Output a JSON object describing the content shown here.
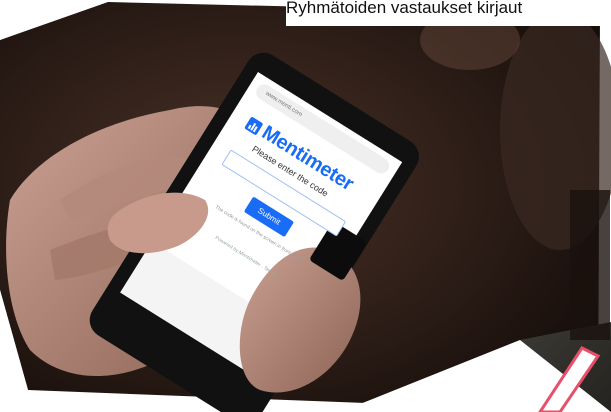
{
  "caption": {
    "text": "Ryhmätoiden vastaukset kirjaut"
  },
  "phone": {
    "url": "www.menti.com",
    "brand": "Mentimeter",
    "prompt": "Please enter the code",
    "code_placeholder": "The code is found on the screen in front of you",
    "submit_label": "Submit",
    "footer": "Powered by Mentimeter  ·  Terms"
  },
  "colors": {
    "brand_blue": "#196cf5",
    "annotation_red": "#e8506a"
  }
}
